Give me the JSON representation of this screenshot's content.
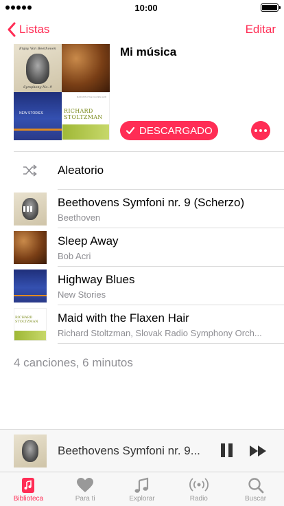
{
  "status_bar": {
    "time": "10:00"
  },
  "nav": {
    "back_label": "Listas",
    "edit_label": "Editar"
  },
  "playlist": {
    "title": "Mi música",
    "downloaded_label": "DESCARGADO",
    "artwork": {
      "tile1_caption_top": "Enjoy Von Beethoven",
      "tile1_caption_bottom": "Symphony No. 9",
      "tile3_caption": "NEW STORIES",
      "tile4_name": "RICHARD STOLTZMAN",
      "tile4_subtitle": "MAID WITH THE FLAXEN HAIR"
    }
  },
  "shuffle": {
    "label": "Aleatorio"
  },
  "tracks": [
    {
      "title": "Beethovens Symfoni nr. 9 (Scherzo)",
      "artist": "Beethoven",
      "playing": true
    },
    {
      "title": "Sleep Away",
      "artist": "Bob Acri",
      "playing": false
    },
    {
      "title": "Highway Blues",
      "artist": "New Stories",
      "playing": false
    },
    {
      "title": "Maid with the Flaxen Hair",
      "artist": "Richard Stoltzman, Slovak Radio Symphony Orch...",
      "playing": false
    }
  ],
  "summary": "4 canciones, 6 minutos",
  "mini_player": {
    "title": "Beethovens Symfoni nr. 9..."
  },
  "tabs": [
    {
      "label": "Biblioteca",
      "icon": "library-icon",
      "active": true
    },
    {
      "label": "Para ti",
      "icon": "heart-icon",
      "active": false
    },
    {
      "label": "Explorar",
      "icon": "music-note-icon",
      "active": false
    },
    {
      "label": "Radio",
      "icon": "radio-icon",
      "active": false
    },
    {
      "label": "Buscar",
      "icon": "search-icon",
      "active": false
    }
  ],
  "colors": {
    "accent": "#ff2d55",
    "secondary_text": "#8e8e93"
  }
}
